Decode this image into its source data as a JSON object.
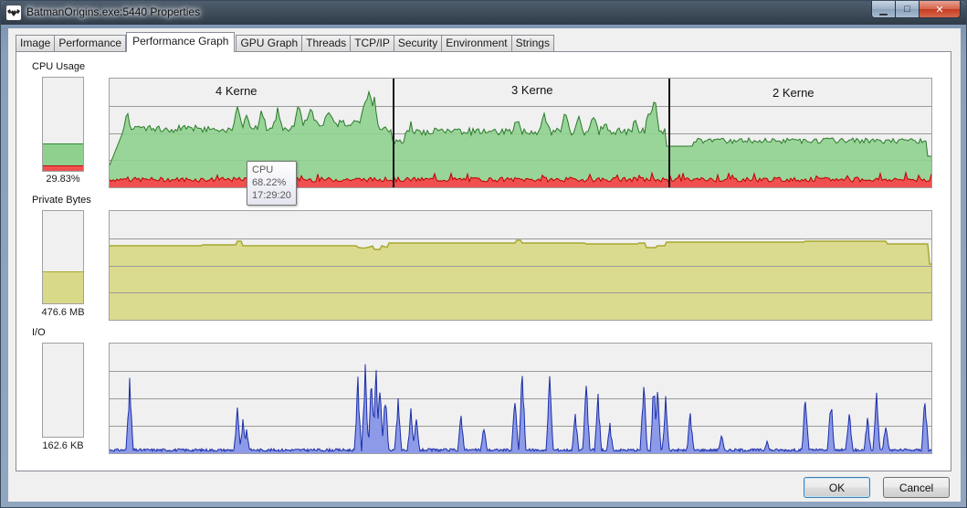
{
  "window": {
    "title": "BatmanOrigins.exe:5440 Properties"
  },
  "titlebar_buttons": [
    {
      "name": "minimize",
      "glyph": "▁"
    },
    {
      "name": "maximize",
      "glyph": "□"
    },
    {
      "name": "close",
      "glyph": "✕"
    }
  ],
  "tabs": [
    {
      "label": "Image",
      "active": false
    },
    {
      "label": "Performance",
      "active": false
    },
    {
      "label": "Performance Graph",
      "active": true
    },
    {
      "label": "GPU Graph",
      "active": false
    },
    {
      "label": "Threads",
      "active": false
    },
    {
      "label": "TCP/IP",
      "active": false
    },
    {
      "label": "Security",
      "active": false
    },
    {
      "label": "Environment",
      "active": false
    },
    {
      "label": "Strings",
      "active": false
    }
  ],
  "cpu": {
    "label": "CPU Usage",
    "value_text": "29.83%",
    "level": 0.2983,
    "kernel_level": 0.06,
    "fill_color": "#8fd08f",
    "kernel_color": "#f05050",
    "section_annotations": [
      "4 Kerne",
      "3 Kerne",
      "2 Kerne"
    ]
  },
  "tooltip": {
    "title": "CPU",
    "value": "68.22%",
    "time": "17:29:20"
  },
  "private_bytes": {
    "label": "Private Bytes",
    "value_text": "476.6 MB",
    "level": 0.35,
    "fill_color": "#d9d98a",
    "line_color": "#a8a830"
  },
  "io": {
    "label": "I/O",
    "value_text": "162.6  KB",
    "fill_color": "#8c9ae8",
    "line_color": "#1c2ea8"
  },
  "buttons": {
    "ok": "OK",
    "cancel": "Cancel"
  },
  "icons": {
    "app_icon": "bat-icon"
  }
}
